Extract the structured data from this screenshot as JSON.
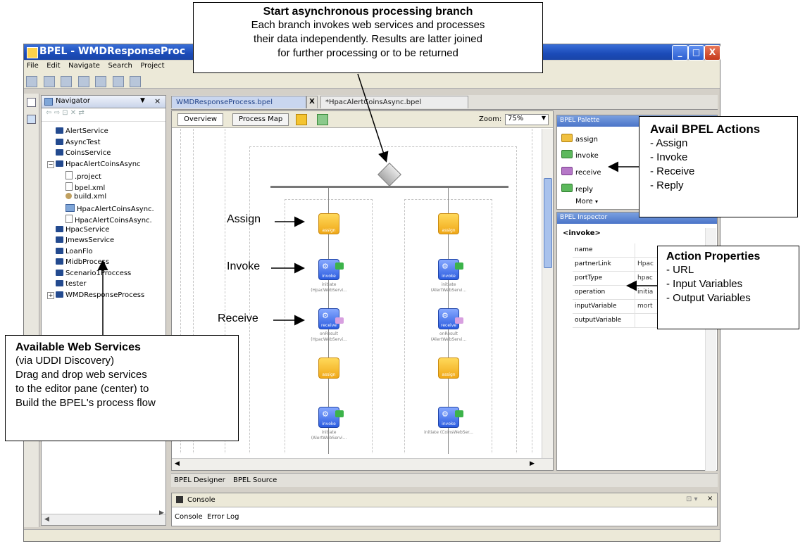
{
  "window": {
    "title": "BPEL - WMDResponseProc",
    "controls": [
      "_",
      "□",
      "X"
    ]
  },
  "menu": [
    "File",
    "Edit",
    "Navigate",
    "Search",
    "Project"
  ],
  "navigator": {
    "title": "Navigator",
    "items": [
      {
        "label": "AlertService",
        "icon": "service-folder-icon",
        "level": 0
      },
      {
        "label": "AsyncTest",
        "icon": "service-folder-icon",
        "level": 0
      },
      {
        "label": "CoinsService",
        "icon": "service-folder-icon",
        "level": 0
      },
      {
        "label": "HpacAlertCoinsAsync",
        "icon": "project-folder-icon",
        "level": 0,
        "expanded": true
      },
      {
        "label": ".project",
        "icon": "file-icon",
        "level": 1
      },
      {
        "label": "bpel.xml",
        "icon": "file-icon",
        "level": 1
      },
      {
        "label": "build.xml",
        "icon": "build-file-icon",
        "level": 1
      },
      {
        "label": "HpacAlertCoinsAsync.",
        "icon": "process-icon",
        "level": 1
      },
      {
        "label": "HpacAlertCoinsAsync.",
        "icon": "file-icon",
        "level": 1
      },
      {
        "label": "HpacService",
        "icon": "service-folder-icon",
        "level": 0
      },
      {
        "label": "JmewsService",
        "icon": "service-folder-icon",
        "level": 0
      },
      {
        "label": "LoanFlo",
        "icon": "service-folder-icon",
        "level": 0
      },
      {
        "label": "MidbProcess",
        "icon": "service-folder-icon",
        "level": 0
      },
      {
        "label": "Scenario1Proccess",
        "icon": "service-folder-icon",
        "level": 0
      },
      {
        "label": "tester",
        "icon": "service-folder-icon",
        "level": 0
      },
      {
        "label": "WMDResponseProcess",
        "icon": "project-folder-icon",
        "level": 0,
        "expanded": false
      }
    ]
  },
  "editor": {
    "tabs": [
      "WMDResponseProcess.bpel",
      "*HpacAlertCoinsAsync.bpel"
    ],
    "overview_btn": "Overview",
    "processmap_btn": "Process Map",
    "zoom_label": "Zoom:",
    "zoom_value": "75%",
    "branches": [
      {
        "steps": [
          {
            "kind": "assign",
            "label": "assign",
            "caption": ""
          },
          {
            "kind": "invoke",
            "label": "invoke",
            "caption": "initiate (HpacWebServi..."
          },
          {
            "kind": "receive",
            "label": "receive",
            "caption": "onResult (HpacWebServi..."
          },
          {
            "kind": "assign",
            "label": "assign",
            "caption": ""
          },
          {
            "kind": "invoke",
            "label": "invoke",
            "caption": "initiate (AlertWebServi..."
          }
        ]
      },
      {
        "steps": [
          {
            "kind": "assign",
            "label": "assign",
            "caption": ""
          },
          {
            "kind": "invoke",
            "label": "invoke",
            "caption": "initiate (AlertWebServi..."
          },
          {
            "kind": "receive",
            "label": "receive",
            "caption": "onResult (AlertWebServi..."
          },
          {
            "kind": "assign",
            "label": "assign",
            "caption": ""
          },
          {
            "kind": "invoke",
            "label": "invoke",
            "caption": "initiate (CoinsWebSer..."
          }
        ]
      }
    ],
    "bottom_tabs": [
      "BPEL Designer",
      "BPEL Source"
    ]
  },
  "palette": {
    "title": "BPEL Palette",
    "items": [
      "assign",
      "invoke",
      "receive",
      "reply"
    ],
    "more": "More"
  },
  "inspector": {
    "title": "BPEL Inspector",
    "node": "<invoke>",
    "rows": [
      {
        "key": "name",
        "value": ""
      },
      {
        "key": "partnerLink",
        "value": "Hpac"
      },
      {
        "key": "portType",
        "value": "hpac"
      },
      {
        "key": "operation",
        "value": "initia"
      },
      {
        "key": "inputVariable",
        "value": "mort"
      },
      {
        "key": "outputVariable",
        "value": ""
      }
    ]
  },
  "console": {
    "title": "Console",
    "tabs": [
      "Console",
      "Error Log"
    ]
  },
  "callouts": {
    "branch": {
      "heading": "Start asynchronous processing branch",
      "lines": [
        "Each branch invokes web services and processes",
        "their data independently.  Results are latter joined",
        "for further processing or to be returned"
      ]
    },
    "actions": {
      "heading": "Avail BPEL Actions",
      "lines": [
        "- Assign",
        "- Invoke",
        "- Receive",
        "- Reply"
      ]
    },
    "properties": {
      "heading": "Action Properties",
      "lines": [
        "- URL",
        "- Input Variables",
        "- Output Variables"
      ]
    },
    "services": {
      "heading": "Available Web Services",
      "lines": [
        "(via UDDI Discovery)",
        "Drag and drop web services",
        "to the editor pane (center) to",
        "Build the BPEL's process flow"
      ]
    },
    "labels": {
      "assign": "Assign",
      "invoke": "Invoke",
      "receive": "Receive"
    }
  }
}
